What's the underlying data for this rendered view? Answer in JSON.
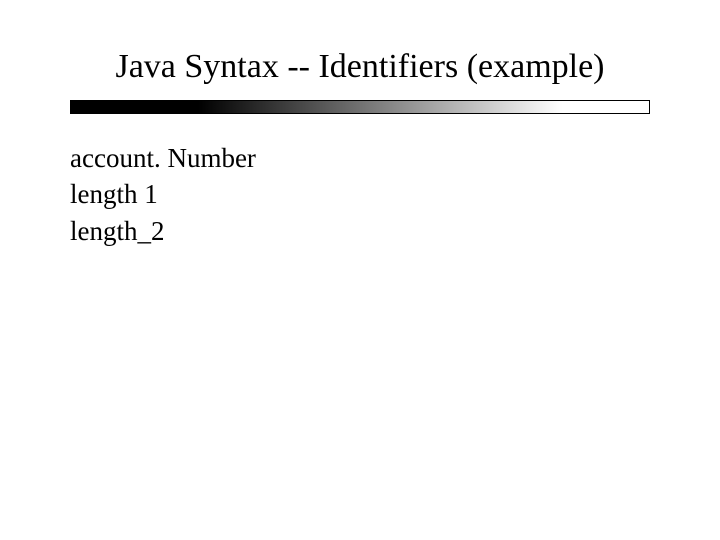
{
  "slide": {
    "title": "Java Syntax -- Identifiers (example)",
    "body": {
      "lines": [
        "account. Number",
        "length 1",
        "length_2"
      ]
    }
  }
}
